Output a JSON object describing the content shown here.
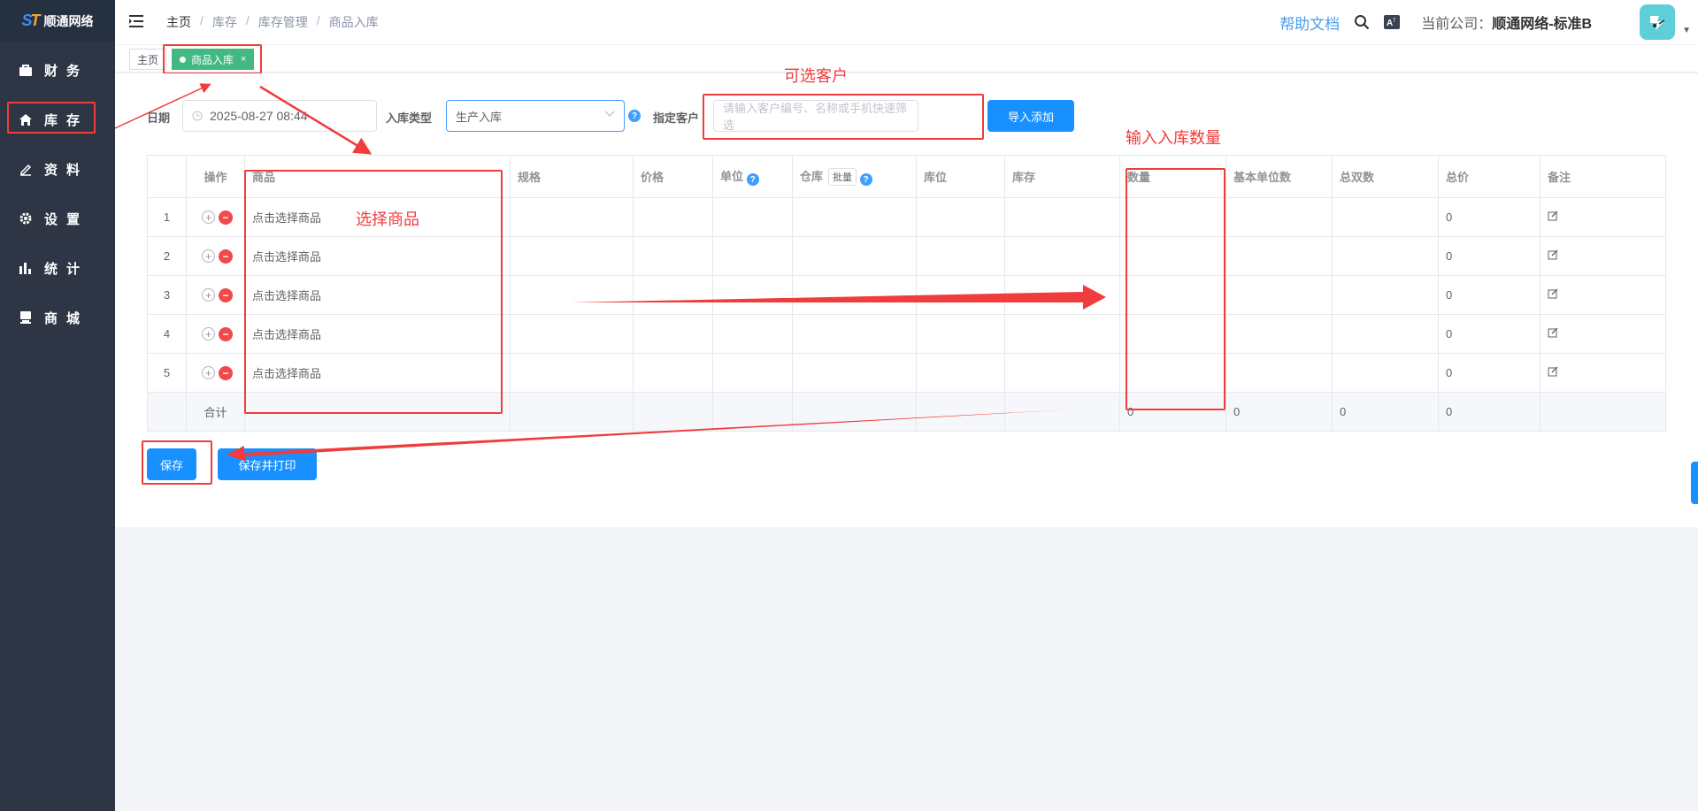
{
  "app": {
    "logo_text": "顺通网络",
    "logo_mark": "ST"
  },
  "sidebar": {
    "items": [
      {
        "label": "财务",
        "icon": "bag-icon"
      },
      {
        "label": "库存",
        "icon": "home-icon"
      },
      {
        "label": "资料",
        "icon": "edit-icon"
      },
      {
        "label": "设置",
        "icon": "gear-icon"
      },
      {
        "label": "统计",
        "icon": "bar-chart-icon"
      },
      {
        "label": "商城",
        "icon": "store-icon"
      }
    ]
  },
  "header": {
    "breadcrumb": [
      "主页",
      "库存",
      "库存管理",
      "商品入库"
    ],
    "help_label": "帮助文档",
    "company_prefix": "当前公司：",
    "company_name": "顺通网络-标准B"
  },
  "tabs": [
    {
      "label": "主页"
    },
    {
      "label": "商品入库",
      "close": "×"
    }
  ],
  "form": {
    "date_label": "日期",
    "date_value": "2025-08-27 08:44",
    "type_label": "入库类型",
    "type_value": "生产入库",
    "customer_label": "指定客户",
    "customer_placeholder": "请输入客户编号、名称或手机快速筛选",
    "import_button": "导入添加",
    "help_mark": "?"
  },
  "table": {
    "headers": [
      "",
      "操作",
      "商品",
      "规格",
      "价格",
      "单位",
      "仓库",
      "库位",
      "库存",
      "数量",
      "基本单位数",
      "总双数",
      "总价",
      "备注"
    ],
    "batch_label": "批量",
    "rows": [
      {
        "index": "1",
        "product_placeholder": "点击选择商品",
        "total": "0"
      },
      {
        "index": "2",
        "product_placeholder": "点击选择商品",
        "total": "0"
      },
      {
        "index": "3",
        "product_placeholder": "点击选择商品",
        "total": "0"
      },
      {
        "index": "4",
        "product_placeholder": "点击选择商品",
        "total": "0"
      },
      {
        "index": "5",
        "product_placeholder": "点击选择商品",
        "total": "0"
      }
    ],
    "summary": {
      "label": "合计",
      "qty": "0",
      "base_units": "0",
      "total_pairs": "0",
      "total_price": "0"
    },
    "add_symbol": "+",
    "del_symbol": "−"
  },
  "actions": {
    "save": "保存",
    "save_print": "保存并打印"
  },
  "annotations": {
    "customer": "可选客户",
    "product": "选择商品",
    "quantity": "输入入库数量"
  },
  "colors": {
    "sidebar": "#2e3645",
    "primary": "#1890ff",
    "active_tab": "#42b983",
    "annotation": "#f03c3c"
  }
}
